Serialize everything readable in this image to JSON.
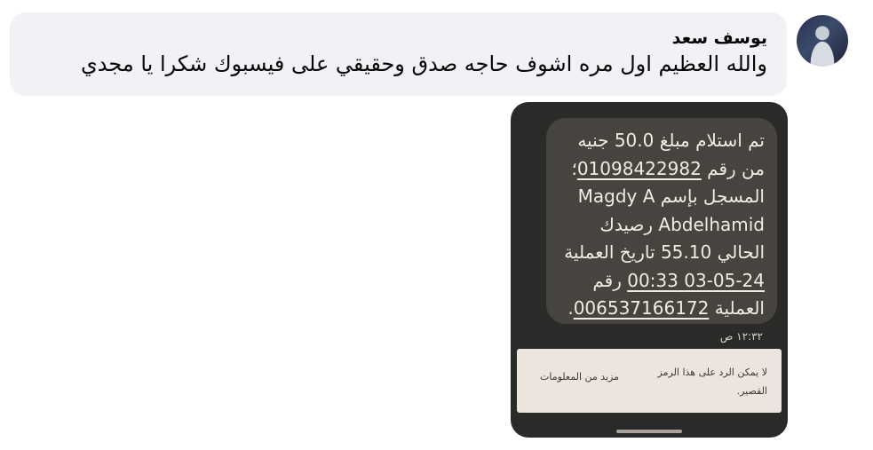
{
  "comment": {
    "author": "يوسف سعد",
    "text": "والله العظيم اول مره اشوف حاجه صدق وحقيقي على فيسبوك شكرا يا مجدي"
  },
  "sms": {
    "lines": [
      {
        "pre": "تم استلام مبلغ 50.0 جنيه",
        "link": "",
        "post": ""
      },
      {
        "pre": "من رقم ",
        "link": "01098422982",
        "post": "؛"
      },
      {
        "pre": "المسجل بإسم Magdy A",
        "link": "",
        "post": ""
      },
      {
        "pre": "Abdelhamid رصيدك",
        "link": "",
        "post": ""
      },
      {
        "pre": "الحالي 55.10  تاريخ العملية",
        "link": "",
        "post": ""
      },
      {
        "pre": "",
        "link": "03-05-24 00:33",
        "post": " رقم"
      },
      {
        "pre": "العملية ",
        "link": "006537166172",
        "post": "."
      }
    ],
    "time": "١٢:٣٢ ص",
    "info_text": "لا يمكن الرد على هذا الرمز القصير.",
    "info_link": "مزيد من المعلومات"
  },
  "colors": {
    "bubble_bg": "#f0f2f5",
    "attachment_bg": "#2a2a28",
    "sms_bubble_bg": "#47443f",
    "info_bg": "#ece5de"
  }
}
